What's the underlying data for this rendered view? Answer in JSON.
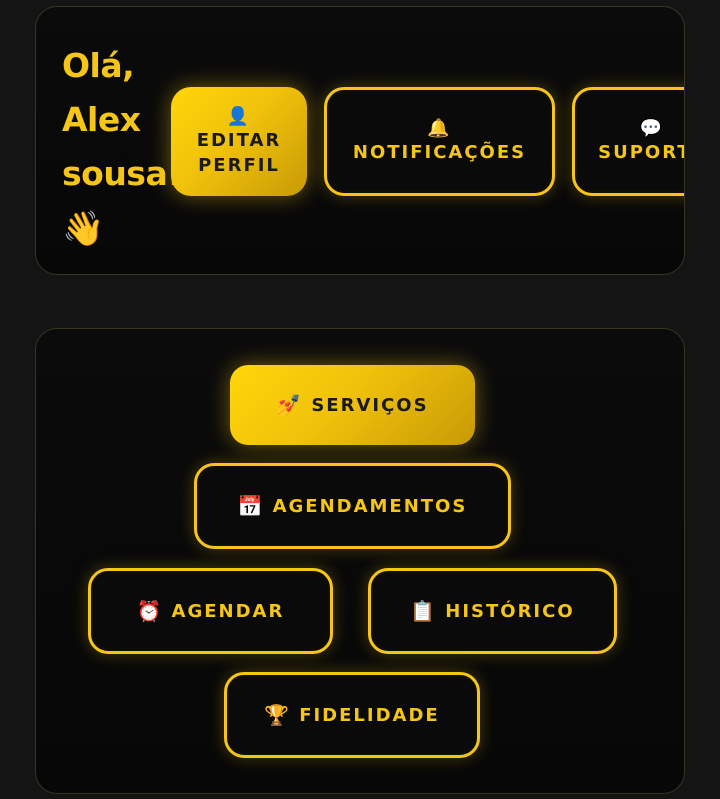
{
  "header": {
    "greeting_line1": "Olá,",
    "greeting_line2": "Alex",
    "greeting_line3": "sousa!",
    "wave_emoji": "👋",
    "buttons": {
      "edit_profile": {
        "icon": "👤",
        "icon_name": "user-silhouette-icon",
        "line1": "EDITAR",
        "line2": "PERFIL"
      },
      "notifications": {
        "icon": "🔔",
        "icon_name": "bell-icon",
        "label": "NOTIFICAÇÕES"
      },
      "support": {
        "icon": "💬",
        "icon_name": "speech-bubble-icon",
        "label": "SUPORTE"
      }
    }
  },
  "menu": {
    "servicos": {
      "icon": "💅",
      "icon_name": "nail-polish-icon",
      "label": "SERVIÇOS",
      "active": true
    },
    "agendamentos": {
      "icon": "📅",
      "icon_name": "calendar-icon",
      "label": "AGENDAMENTOS"
    },
    "agendar": {
      "icon": "⏰",
      "icon_name": "alarm-clock-icon",
      "label": "AGENDAR"
    },
    "historico": {
      "icon": "📋",
      "icon_name": "clipboard-icon",
      "label": "HISTÓRICO"
    },
    "fidelidade": {
      "icon": "🏆",
      "icon_name": "trophy-icon",
      "label": "FIDELIDADE"
    }
  },
  "colors": {
    "accent": "#f5c518",
    "background": "#141414",
    "card": "#0a0a0a"
  }
}
